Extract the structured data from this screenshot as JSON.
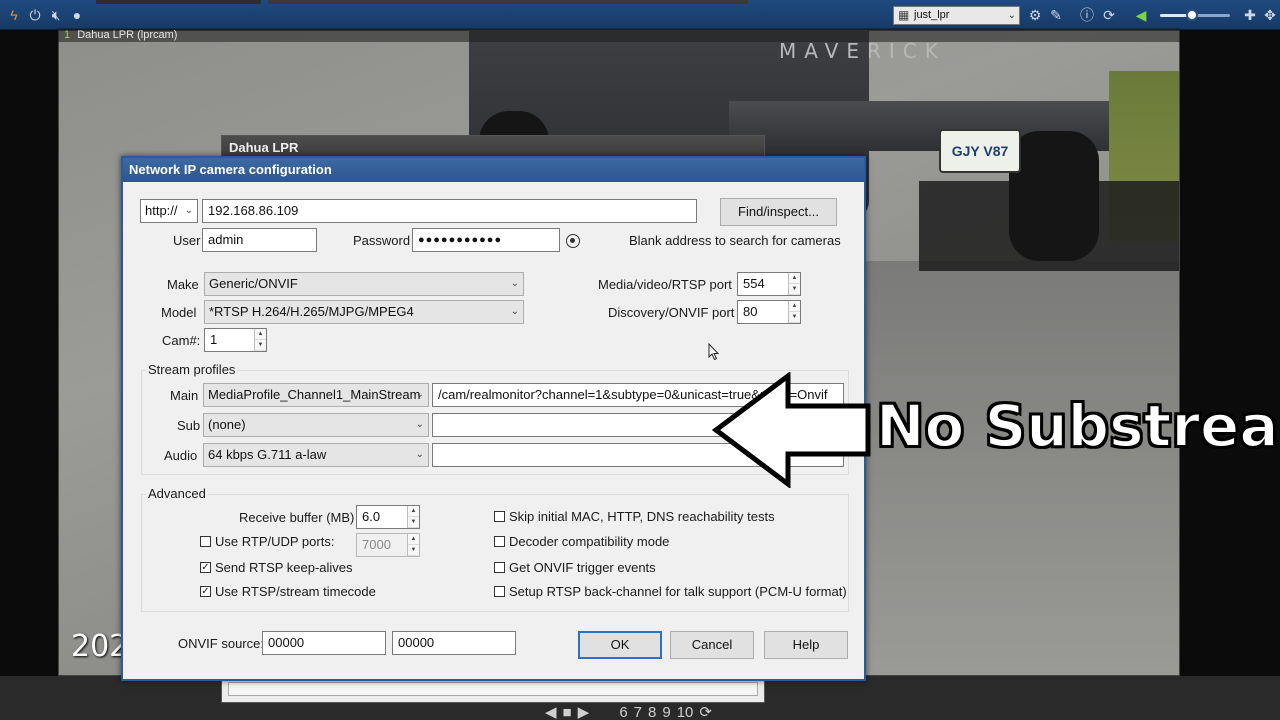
{
  "topbar": {
    "layout_value": "just_lpr",
    "icons": [
      "lightning-icon",
      "power-icon",
      "mute-icon",
      "mic-icon",
      "grid-icon",
      "gear-icon",
      "edit-icon",
      "info-icon",
      "refresh-icon",
      "volume-icon",
      "plus-icon",
      "move-icon"
    ],
    "volume_fraction": 0.45
  },
  "camera": {
    "index": "1",
    "title": "Dahua LPR (lprcam)",
    "timestamp": "202",
    "truck_text": "MAVERICK",
    "plate": "GJY V87"
  },
  "bottombar": {
    "pages": [
      "6",
      "7",
      "8",
      "9",
      "10"
    ]
  },
  "bg_dialog": {
    "title": "Dahua LPR"
  },
  "dialog": {
    "title": "Network IP camera configuration",
    "protocol": "http://",
    "address": "192.168.86.109",
    "find_button": "Find/inspect...",
    "user_label": "User",
    "user_value": "admin",
    "password_label": "Password",
    "password_value": "●●●●●●●●●●●",
    "hint": "Blank address to search for cameras",
    "make_label": "Make",
    "make_value": "Generic/ONVIF",
    "model_label": "Model",
    "model_value": "*RTSP H.264/H.265/MJPG/MPEG4",
    "cam_label": "Cam#:",
    "cam_value": "1",
    "media_port_label": "Media/video/RTSP port",
    "media_port_value": "554",
    "discovery_port_label": "Discovery/ONVIF port",
    "discovery_port_value": "80",
    "stream_profiles": {
      "title": "Stream profiles",
      "main_label": "Main",
      "main_profile": "MediaProfile_Channel1_MainStream",
      "main_path": "/cam/realmonitor?channel=1&subtype=0&unicast=true&proto=Onvif",
      "sub_label": "Sub",
      "sub_profile": "(none)",
      "sub_path": "",
      "audio_label": "Audio",
      "audio_profile": "64 kbps G.711 a-law",
      "audio_path": ""
    },
    "advanced": {
      "title": "Advanced",
      "receive_buffer_label": "Receive buffer (MB)",
      "receive_buffer_value": "6.0",
      "rtp_udp_label": "Use RTP/UDP ports:",
      "rtp_udp_value": "7000",
      "keepalive_label": "Send RTSP keep-alives",
      "timecode_label": "Use RTSP/stream timecode",
      "skip_tests_label": "Skip initial MAC, HTTP, DNS reachability tests",
      "decoder_compat_label": "Decoder compatibility mode",
      "onvif_trigger_label": "Get ONVIF trigger events",
      "backchannel_label": "Setup RTSP back-channel for talk support (PCM-U format)"
    },
    "onvif_source_label": "ONVIF source:",
    "onvif_source_1": "00000",
    "onvif_source_2": "00000",
    "ok": "OK",
    "cancel": "Cancel",
    "help": "Help"
  },
  "annotation": {
    "text": "No Substream"
  },
  "colors": {
    "title_bar": "#2c5690",
    "toolbar": "#1f4a80",
    "default_button_border": "#2a72c8"
  }
}
